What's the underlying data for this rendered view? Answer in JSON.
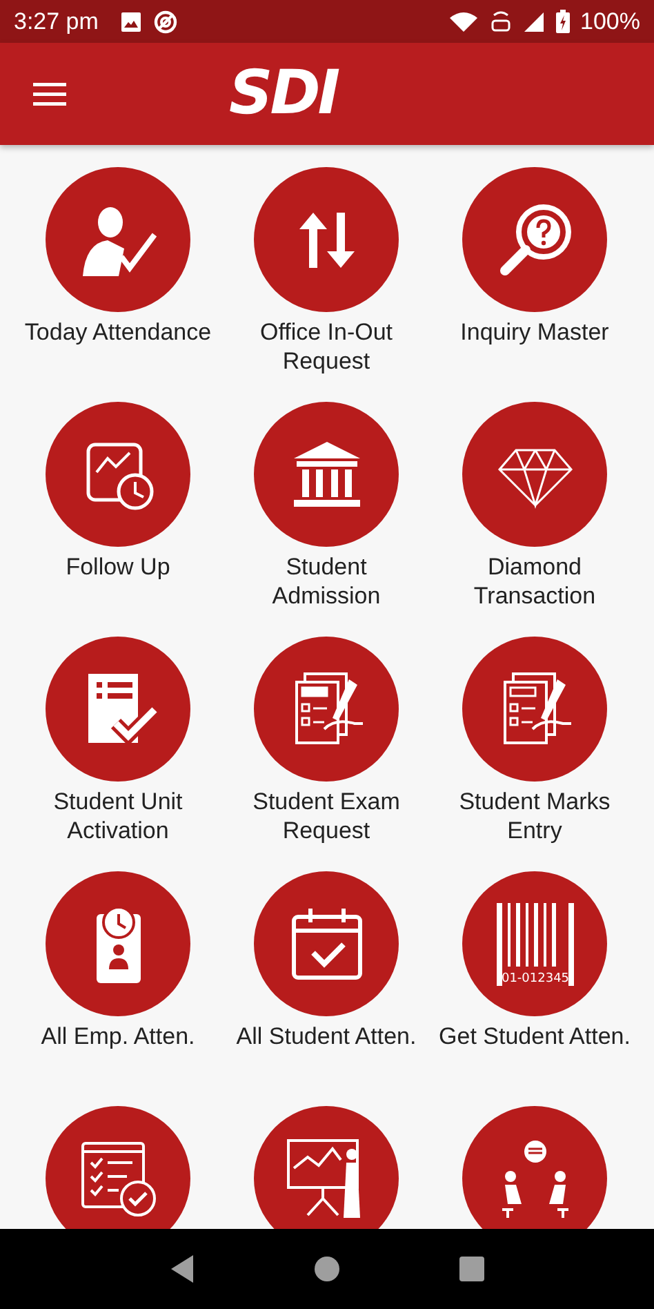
{
  "status_bar": {
    "time": "3:27 pm",
    "battery": "100%"
  },
  "app_bar": {
    "logo": "SDI"
  },
  "tile_rows": [
    [
      {
        "kind": "attendance",
        "label_lines": [
          "Today Attendance"
        ]
      },
      {
        "kind": "updown",
        "label_lines": [
          "Office In-Out",
          "Request"
        ]
      },
      {
        "kind": "inquiry",
        "label_lines": [
          "Inquiry Master"
        ]
      }
    ],
    [
      {
        "kind": "followup",
        "label_lines": [
          "Follow Up"
        ]
      },
      {
        "kind": "bank",
        "label_lines": [
          "Student",
          "Admission"
        ]
      },
      {
        "kind": "diamond",
        "label_lines": [
          "Diamond",
          "Transaction"
        ]
      }
    ],
    [
      {
        "kind": "formcheck",
        "label_lines": [
          "Student Unit",
          "Activation"
        ]
      },
      {
        "kind": "exam",
        "label_lines": [
          "Student Exam",
          "Request"
        ]
      },
      {
        "kind": "marks",
        "label_lines": [
          "Student Marks",
          "Entry"
        ]
      }
    ],
    [
      {
        "kind": "idclock",
        "label_lines": [
          "All Emp. Atten."
        ]
      },
      {
        "kind": "calendar",
        "label_lines": [
          "All Student Atten."
        ]
      },
      {
        "kind": "barcode",
        "label_lines": [
          "Get Student Atten."
        ],
        "icon_text": "01-012345"
      }
    ],
    [
      {
        "kind": "checklist"
      },
      {
        "kind": "presentation"
      },
      {
        "kind": "meeting"
      }
    ]
  ]
}
